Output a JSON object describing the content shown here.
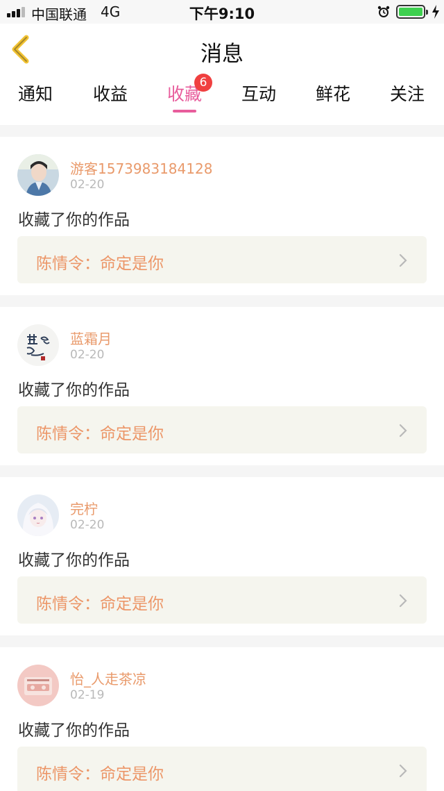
{
  "status_bar": {
    "carrier": "中国联通",
    "network": "4G",
    "time": "下午9:10"
  },
  "header": {
    "title": "消息"
  },
  "tabs": [
    {
      "label": "通知"
    },
    {
      "label": "收益"
    },
    {
      "label": "收藏",
      "badge": "6",
      "active": true
    },
    {
      "label": "互动"
    },
    {
      "label": "鲜花"
    },
    {
      "label": "关注"
    }
  ],
  "messages": [
    {
      "username": "游客1573983184128",
      "date": "02-20",
      "action": "收藏了你的作品",
      "work_title": "陈情令：命定是你"
    },
    {
      "username": "蓝霜月",
      "date": "02-20",
      "action": "收藏了你的作品",
      "work_title": "陈情令：命定是你"
    },
    {
      "username": "完柠",
      "date": "02-20",
      "action": "收藏了你的作品",
      "work_title": "陈情令：命定是你"
    },
    {
      "username": "怡_人走茶凉",
      "date": "02-19",
      "action": "收藏了你的作品",
      "work_title": "陈情令：命定是你"
    }
  ],
  "colors": {
    "accent": "#e85d9c",
    "username": "#e99a6b",
    "badge": "#f04040",
    "back_icon": "#f1c232"
  },
  "icons": {
    "back": "chevron-left-icon",
    "row_arrow": "chevron-right-icon",
    "alarm": "alarm-clock-icon",
    "battery": "battery-icon",
    "charging": "lightning-bolt-icon"
  }
}
